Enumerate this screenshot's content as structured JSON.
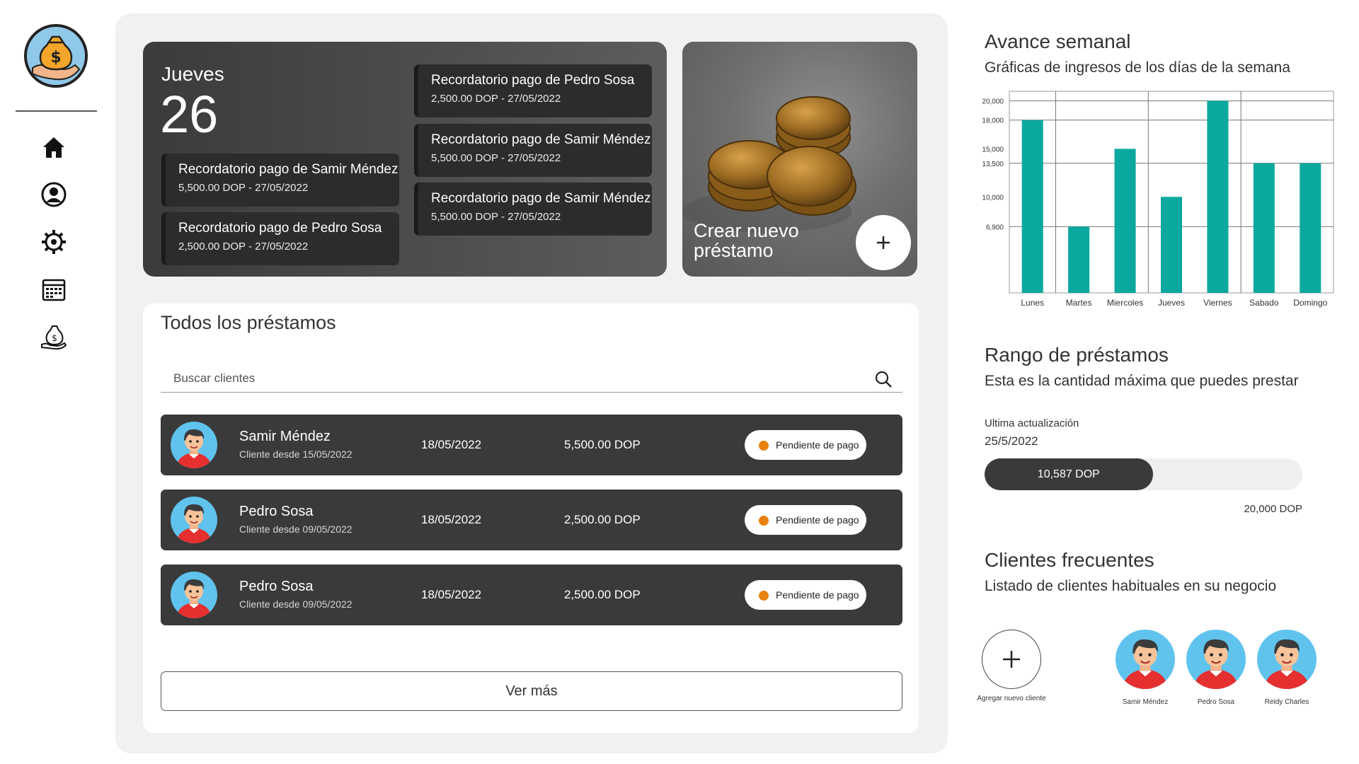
{
  "sidebar": {
    "logo": "money-bag-hand-logo",
    "icons": [
      "home-icon",
      "user-circle-icon",
      "settings-gear-icon",
      "calendar-icon",
      "money-bag-icon"
    ]
  },
  "date_card": {
    "day_name": "Jueves",
    "day_number": "26",
    "reminders": [
      {
        "title": "Recordatorio pago de Samir Méndez",
        "detail": "5,500.00 DOP - 27/05/2022"
      },
      {
        "title": "Recordatorio pago de Pedro Sosa",
        "detail": "2,500.00 DOP - 27/05/2022"
      },
      {
        "title": "Recordatorio pago de Pedro Sosa",
        "detail": "2,500.00 DOP - 27/05/2022"
      },
      {
        "title": "Recordatorio pago de Samir Méndez",
        "detail": "5,500.00 DOP - 27/05/2022"
      },
      {
        "title": "Recordatorio pago de Samir Méndez",
        "detail": "5,500.00 DOP - 27/05/2022"
      }
    ]
  },
  "new_loan": {
    "label": "Crear nuevo préstamo",
    "button_icon": "plus-icon"
  },
  "loans": {
    "title": "Todos los préstamos",
    "search_placeholder": "Buscar clientes",
    "rows": [
      {
        "name": "Samir Méndez",
        "since": "Cliente desde 15/05/2022",
        "date": "18/05/2022",
        "amount": "5,500.00 DOP",
        "status": "Pendiente de pago"
      },
      {
        "name": "Pedro Sosa",
        "since": "Cliente desde 09/05/2022",
        "date": "18/05/2022",
        "amount": "2,500.00 DOP",
        "status": "Pendiente de pago"
      },
      {
        "name": "Pedro Sosa",
        "since": "Cliente desde 09/05/2022",
        "date": "18/05/2022",
        "amount": "2,500.00 DOP",
        "status": "Pendiente de pago"
      }
    ],
    "see_more": "Ver más",
    "status_color": "#e8820e"
  },
  "weekly": {
    "title": "Avance semanal",
    "subtitle": "Gráficas de ingresos de los días de la semana"
  },
  "chart_data": {
    "type": "bar",
    "categories": [
      "Lunes",
      "Martes",
      "Miercoles",
      "Jueves",
      "Viernes",
      "Sabado",
      "Domingo"
    ],
    "values": [
      18000,
      6900,
      15000,
      10000,
      20000,
      13500,
      13500
    ],
    "y_tick_labels": [
      "20,000",
      "18,000",
      "15,000",
      "13,500",
      "10,000",
      "6,900"
    ],
    "y_tick_values": [
      20000,
      18000,
      15000,
      13500,
      10000,
      6900
    ],
    "ylim": [
      0,
      21000
    ],
    "bar_color": "#0aa89e",
    "grid": true
  },
  "range": {
    "title": "Rango de préstamos",
    "subtitle": "Esta es la cantidad máxima que puedes prestar",
    "update_label": "Ultima actualización",
    "update_date": "25/5/2022",
    "current_label": "10,587 DOP",
    "max_label": "20,000 DOP",
    "current_value": 10587,
    "max_value": 20000
  },
  "frequent": {
    "title": "Clientes frecuentes",
    "subtitle": "Listado de clientes habituales en su negocio",
    "add_label": "Agregar nuevo cliente",
    "clients": [
      "Samir Méndez",
      "Pedro Sosa",
      "Reidy Charles"
    ]
  }
}
